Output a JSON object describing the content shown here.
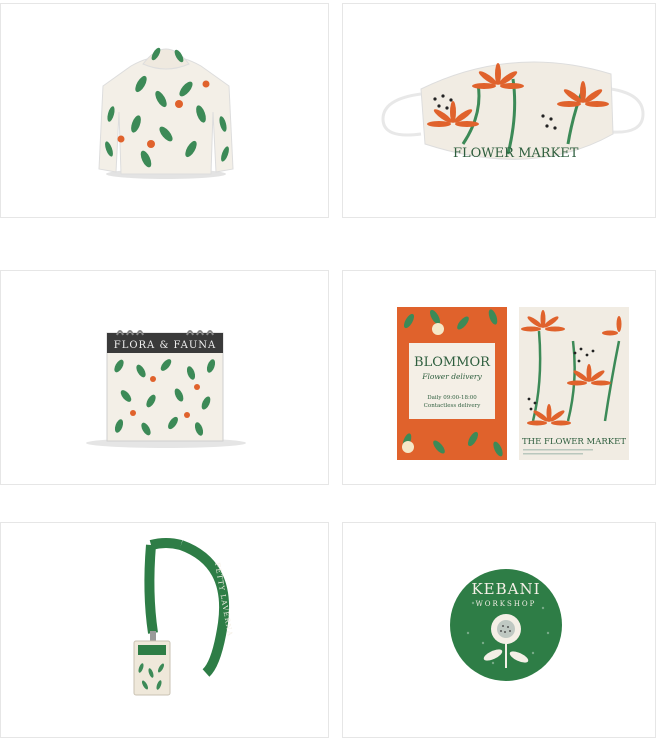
{
  "gallery": {
    "items": [
      {
        "name": "hoodie"
      },
      {
        "name": "face-mask",
        "print_text": "FLOWER MARKET"
      },
      {
        "name": "desk-calendar",
        "title": "FLORA & FAUNA"
      },
      {
        "name": "posters",
        "poster_left": {
          "title": "BLOMMOR",
          "subtitle": "Flower delivery",
          "hours": "Daily 09:00-18:00",
          "note": "Contactless delivery"
        },
        "poster_right": {
          "title": "THE FLOWER MARKET"
        }
      },
      {
        "name": "lanyard",
        "strap_text": "FETTY LAVERNA"
      },
      {
        "name": "round-sticker",
        "title": "KEBANI",
        "subtitle": "WORKSHOP"
      }
    ]
  },
  "colors": {
    "green": "#2e7d46",
    "leaf": "#3c8a57",
    "orange": "#e0622c",
    "cream": "#f4efe6",
    "card_border": "#e6e6e6"
  }
}
